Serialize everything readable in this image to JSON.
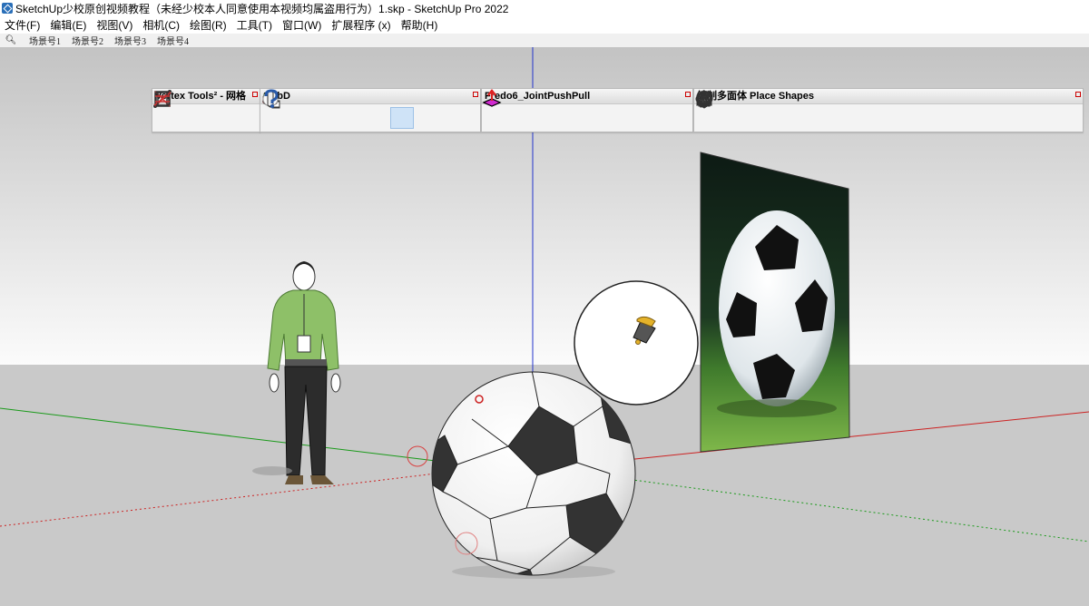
{
  "window": {
    "title": "SketchUp少校原创视频教程（未经少校本人同意使用本视频均属盗用行为）1.skp - SketchUp Pro 2022"
  },
  "menu": [
    {
      "id": "file",
      "label": "文件(F)"
    },
    {
      "id": "edit",
      "label": "编辑(E)"
    },
    {
      "id": "view",
      "label": "视图(V)"
    },
    {
      "id": "camera",
      "label": "相机(C)"
    },
    {
      "id": "draw",
      "label": "绘图(R)"
    },
    {
      "id": "tools",
      "label": "工具(T)"
    },
    {
      "id": "window",
      "label": "窗口(W)"
    },
    {
      "id": "extensions",
      "label": "扩展程序 (x)"
    },
    {
      "id": "help",
      "label": "帮助(H)"
    }
  ],
  "scenes": [
    "场景号1",
    "场景号2",
    "场景号3",
    "场景号4"
  ],
  "toolbars": {
    "vertex": {
      "title": "Vertex Tools² - 网格",
      "tools": [
        "vertex-line-icon",
        "vertex-cross-icon",
        "vertex-box-icon",
        "vertex-grid-icon"
      ]
    },
    "subd": {
      "title": "SUbD",
      "tools": [
        "subd-cube-icon",
        "subd-add-icon",
        "subd-remove-icon",
        "subd-crease-icon",
        "subd-extrude-icon",
        "subd-smooth-icon",
        "subd-knife-icon",
        "subd-help-icon"
      ]
    },
    "fredo": {
      "title": "Fredo6_JointPushPull",
      "tools": [
        "jpp-vector-icon",
        "jpp-normal-icon",
        "jpp-joint-icon",
        "jpp-round-icon",
        "jpp-vector2-icon",
        "jpp-normal2-icon",
        "jpp-extrude-icon",
        "jpp-follow-icon"
      ]
    },
    "shapes": {
      "title": "绘制多面体 Place Shapes",
      "tools": [
        "box-icon",
        "prism-icon",
        "wedge-icon",
        "pyramid-icon",
        "frustum-icon",
        "circle-icon",
        "cylinder-icon",
        "cone-icon",
        "dome-icon",
        "lens-icon",
        "torus-icon",
        "polyhedron-icon",
        "sphere-icon",
        "geodesic-icon",
        "arch-icon"
      ]
    }
  },
  "colors": {
    "sky_top": "#bfbfbf",
    "ground": "#c8c8c8",
    "axis_red": "#cc2222",
    "axis_green": "#1a9a1a",
    "axis_blue": "#2233cc"
  }
}
